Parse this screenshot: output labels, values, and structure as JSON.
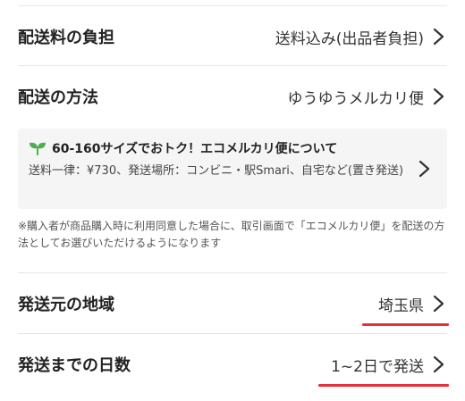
{
  "shipping_fee": {
    "label": "配送料の負担",
    "value": "送料込み(出品者負担)"
  },
  "shipping_method": {
    "label": "配送の方法",
    "value": "ゆうゆうメルカリ便"
  },
  "eco_box": {
    "icon": "sprout-icon",
    "icon_color": "#4caf50",
    "title": "60-160サイズでおトク！エコメルカリ便について",
    "body": "送料一律：¥730、発送場所：コンビニ・駅Smari、自宅など(置き発送)"
  },
  "note": "※購入者が商品購入時に利用同意した場合に、取引画面で「エコメルカリ便」を配送の方法としてお選びいただけるようになります",
  "ship_from": {
    "label": "発送元の地域",
    "value": "埼玉県"
  },
  "days_to_ship": {
    "label": "発送までの日数",
    "value": "1~2日で発送"
  },
  "colors": {
    "underline": "#e8303a",
    "divider": "#e6e6e6",
    "info_background": "#f5f5f5"
  }
}
